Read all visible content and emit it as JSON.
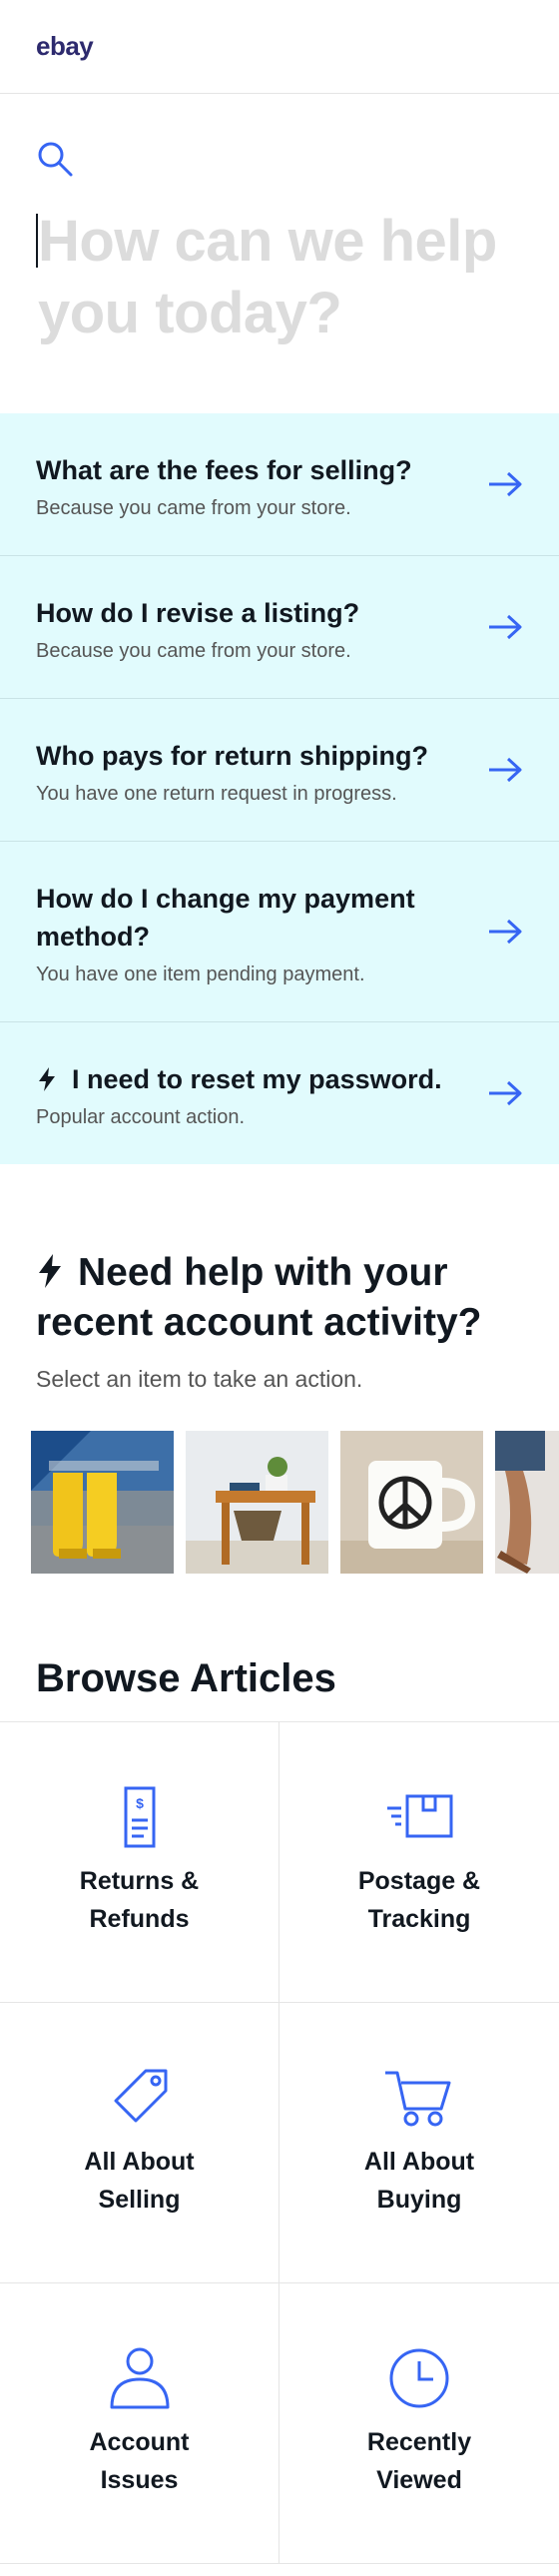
{
  "header": {
    "logo": "ebay"
  },
  "search": {
    "placeholder": "How can we help you today?"
  },
  "suggestions": [
    {
      "title": "What are the fees for selling?",
      "sub": "Because you came from your store.",
      "bolt": false
    },
    {
      "title": "How do I revise a listing?",
      "sub": "Because you came from your store.",
      "bolt": false
    },
    {
      "title": "Who pays for return shipping?",
      "sub": "You have one return request in progress.",
      "bolt": false
    },
    {
      "title": "How do I change my payment method?",
      "sub": "You have one item pending payment.",
      "bolt": false
    },
    {
      "title": "I need to reset my password.",
      "sub": "Popular account action.",
      "bolt": true
    }
  ],
  "activity": {
    "title": "Need help with your recent account activity?",
    "sub": "Select an item to take an action.",
    "items": [
      "yellow-boots",
      "wooden-side-table",
      "peace-mug",
      "sandals"
    ]
  },
  "browse": {
    "title": "Browse Articles",
    "categories": [
      {
        "label": "Returns & Refunds",
        "icon": "receipt-icon"
      },
      {
        "label": "Postage & Tracking",
        "icon": "package-icon"
      },
      {
        "label": "All About Selling",
        "icon": "tag-icon"
      },
      {
        "label": "All About Buying",
        "icon": "cart-icon"
      },
      {
        "label": "Account Issues",
        "icon": "person-icon"
      },
      {
        "label": "Recently Viewed",
        "icon": "clock-icon"
      }
    ]
  },
  "colors": {
    "accent": "#3665f3",
    "suggestion_bg": "#e1fbfd",
    "logo": "#2d2a6e"
  }
}
